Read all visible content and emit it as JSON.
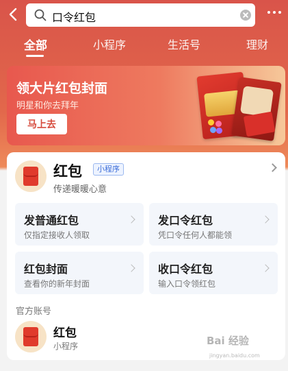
{
  "header": {
    "search_query": "口令红包",
    "icons": [
      "back-icon",
      "search-icon",
      "clear-icon",
      "more-icon"
    ]
  },
  "tabs": [
    {
      "label": "全部",
      "active": true
    },
    {
      "label": "小程序",
      "active": false
    },
    {
      "label": "生活号",
      "active": false
    },
    {
      "label": "理财",
      "active": false
    }
  ],
  "banner": {
    "title": "领大片红包封面",
    "subtitle": "明星和你去拜年",
    "button": "马上去"
  },
  "app": {
    "name": "红包",
    "tag": "小程序",
    "description": "传递暖暖心意"
  },
  "actions": [
    {
      "title": "发普通红包",
      "subtitle": "仅指定接收人领取"
    },
    {
      "title": "发口令红包",
      "subtitle": "凭口令任何人都能领"
    },
    {
      "title": "红包封面",
      "subtitle": "查看你的新年封面"
    },
    {
      "title": "收口令红包",
      "subtitle": "输入口令领红包"
    }
  ],
  "official": {
    "section_label": "官方账号",
    "name": "红包",
    "type": "小程序"
  },
  "watermark": {
    "text": "Bai 经验",
    "sub": "jingyan.baidu.com"
  },
  "colors": {
    "brand_red": "#e03b2c",
    "tag_blue": "#3e6fd9"
  }
}
